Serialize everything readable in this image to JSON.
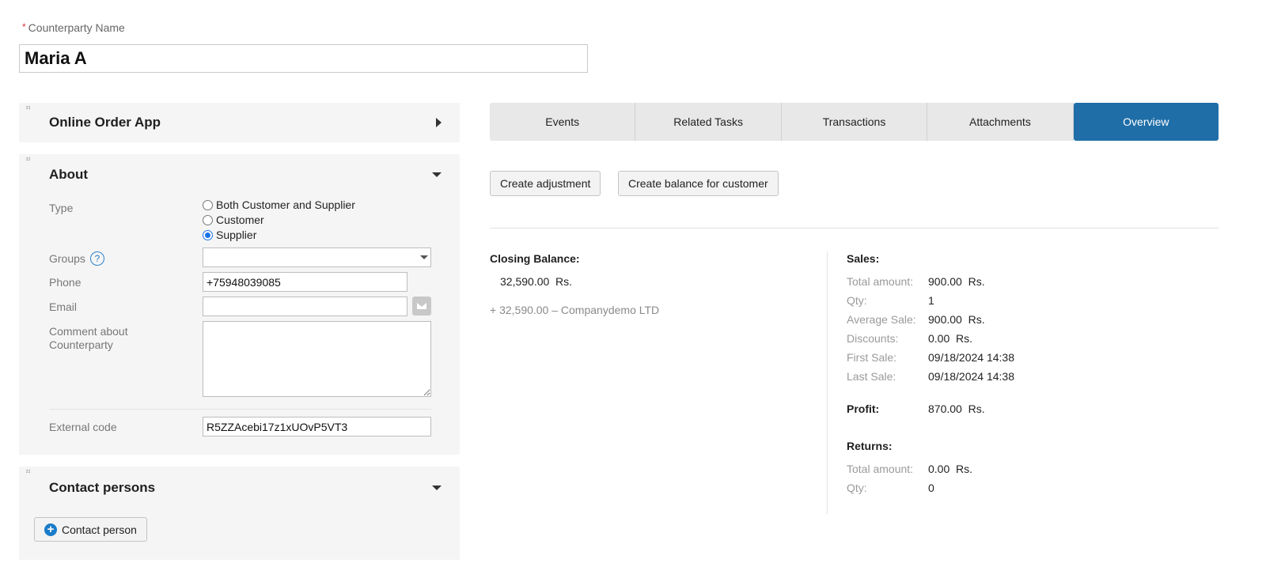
{
  "counterparty": {
    "required_mark": "*",
    "label": "Counterparty Name",
    "value": "Maria A"
  },
  "panels": {
    "online_order": {
      "title": "Online Order App"
    },
    "about": {
      "title": "About",
      "type_label": "Type",
      "type_options": [
        "Both Customer and Supplier",
        "Customer",
        "Supplier"
      ],
      "type_selected": "Supplier",
      "groups_label": "Groups",
      "groups_help": "?",
      "groups_value": "",
      "phone_label": "Phone",
      "phone_value": "+75948039085",
      "email_label": "Email",
      "email_value": "",
      "comment_label": "Comment about Counterparty",
      "comment_value": "",
      "external_code_label": "External code",
      "external_code_value": "R5ZZAcebi17z1xUOvP5VT3"
    },
    "contacts": {
      "title": "Contact persons",
      "add_button_label": "Contact person",
      "add_button_icon": "plus-icon"
    }
  },
  "tabs": [
    {
      "label": "Events",
      "active": false
    },
    {
      "label": "Related Tasks",
      "active": false
    },
    {
      "label": "Transactions",
      "active": false
    },
    {
      "label": "Attachments",
      "active": false
    },
    {
      "label": "Overview",
      "active": true
    }
  ],
  "actions": {
    "create_adjustment": "Create adjustment",
    "create_balance": "Create balance for customer"
  },
  "overview": {
    "closing_balance_title": "Closing Balance:",
    "closing_balance_value": "32,590.00  Rs.",
    "balance_detail": "+ 32,590.00 – Companydemo LTD",
    "sales": {
      "title": "Sales:",
      "rows": [
        {
          "label": "Total amount:",
          "value": "900.00  Rs."
        },
        {
          "label": "Qty:",
          "value": "1"
        },
        {
          "label": "Average Sale:",
          "value": "900.00  Rs."
        },
        {
          "label": "Discounts:",
          "value": "0.00  Rs."
        },
        {
          "label": "First Sale:",
          "value": "09/18/2024 14:38"
        },
        {
          "label": "Last Sale:",
          "value": "09/18/2024 14:38"
        }
      ]
    },
    "profit": {
      "label": "Profit:",
      "value": "870.00  Rs."
    },
    "returns": {
      "title": "Returns:",
      "rows": [
        {
          "label": "Total amount:",
          "value": "0.00  Rs."
        },
        {
          "label": "Qty:",
          "value": "0"
        }
      ]
    }
  },
  "colors": {
    "accent": "#1f6ea8",
    "radio_selected": "#1a73e8",
    "required": "#dd3333"
  }
}
